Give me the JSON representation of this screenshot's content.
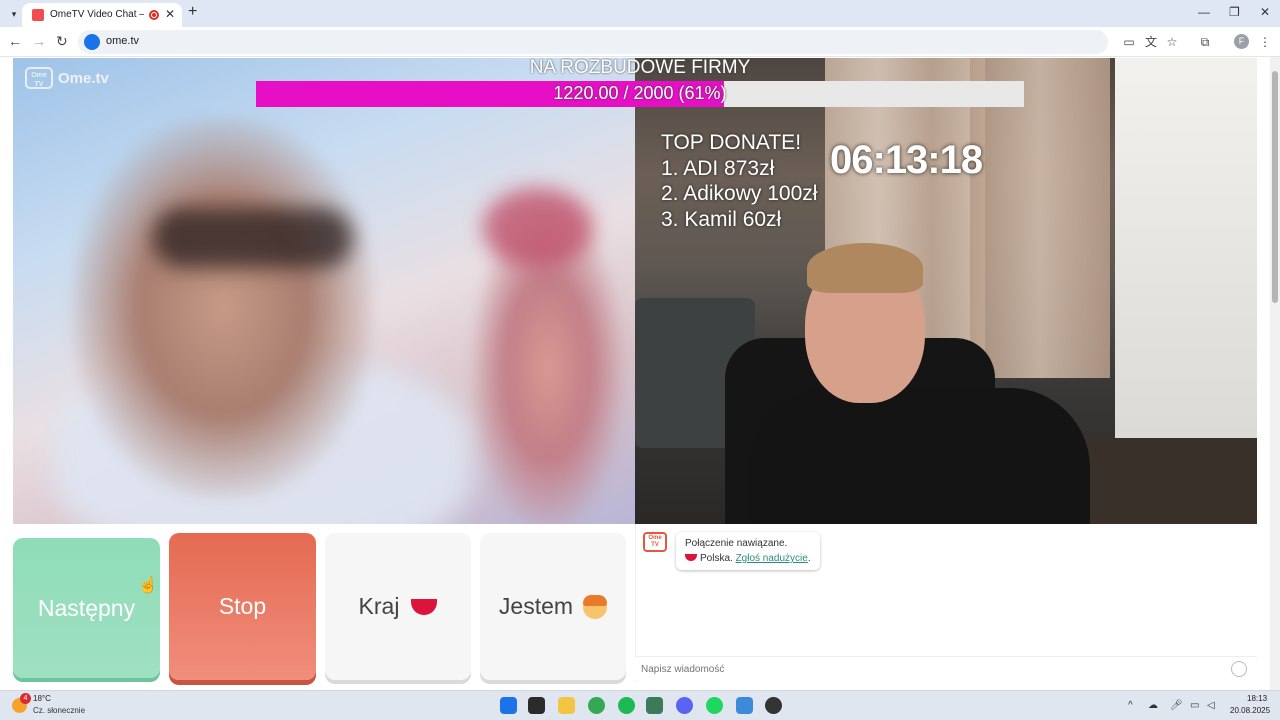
{
  "browser": {
    "tab_title": "OmeTV Video Chat — Ome",
    "url": "ome.tv",
    "profile_initial": "F"
  },
  "overlay": {
    "goal_title": "NA ROZBUDOWE FIRMY",
    "goal_text": "1220.00 / 2000 (61%)",
    "goal_progress": 0.61,
    "goal_color": "#e60fc6",
    "top_donate_title": "TOP DONATE!",
    "top_donate": [
      "1. ADI 873zł",
      "2. Adikowy 100zł",
      "3. Kamil 60zł"
    ],
    "timer": "06:13:18"
  },
  "logo": {
    "text": "Ome.tv",
    "badge_line1": "Ome",
    "badge_line2": "TV"
  },
  "controls": {
    "next_label": "Następny",
    "stop_label": "Stop",
    "country_label": "Kraj",
    "gender_label": "Jestem"
  },
  "chat": {
    "avatar_line1": "Ome",
    "avatar_line2": "TV",
    "message_line1": "Połączenie nawiązane.",
    "country": "Polska.",
    "report_link": "Zgłoś nadużycie",
    "trailing": ".",
    "input_placeholder": "Napisz wiadomość"
  },
  "taskbar": {
    "weather_badge": "4",
    "temperature": "18°C",
    "weather_desc": "Cz. słonecznie",
    "time": "18:13",
    "date": "20.08.2025"
  },
  "colors": {
    "next_button": "#9fe0c2",
    "stop_button": "#e56a52",
    "link": "#2a8f7a"
  }
}
